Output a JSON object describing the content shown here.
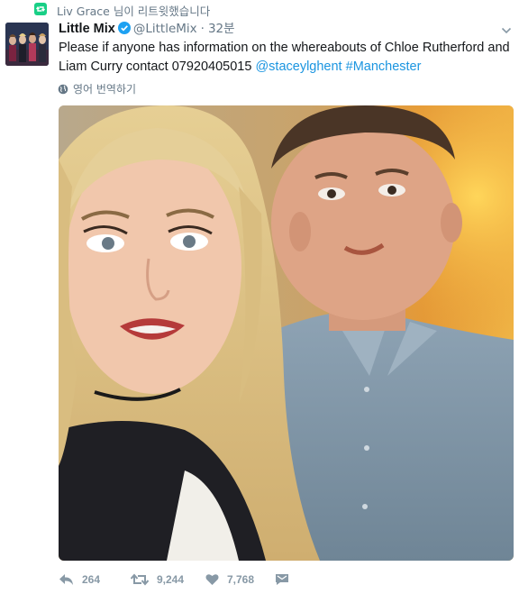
{
  "retweet_context": {
    "text": "Liv Grace 님이 리트윗했습니다"
  },
  "tweet": {
    "author_name": "Little Mix",
    "author_handle": "@LittleMix",
    "separator": "·",
    "time": "32분",
    "text_plain": "Please if anyone has information on the whereabouts of Chloe Rutherford and Liam Curry contact 07920405015",
    "mention": "@staceylghent",
    "hashtag": "#Manchester",
    "translate_label": "영어 번역하기"
  },
  "actions": {
    "replies": "264",
    "retweets": "9,244",
    "likes": "7,768"
  },
  "colors": {
    "text": "#14171a",
    "secondary": "#657786",
    "link": "#1b95e0",
    "verified": "#1da1f2",
    "retweet_green": "#19cf86",
    "action_gray": "#8899a6"
  },
  "icons": [
    "retweet-icon",
    "verified-icon",
    "caret-down-icon",
    "globe-icon",
    "reply-icon",
    "like-icon",
    "message-icon"
  ]
}
